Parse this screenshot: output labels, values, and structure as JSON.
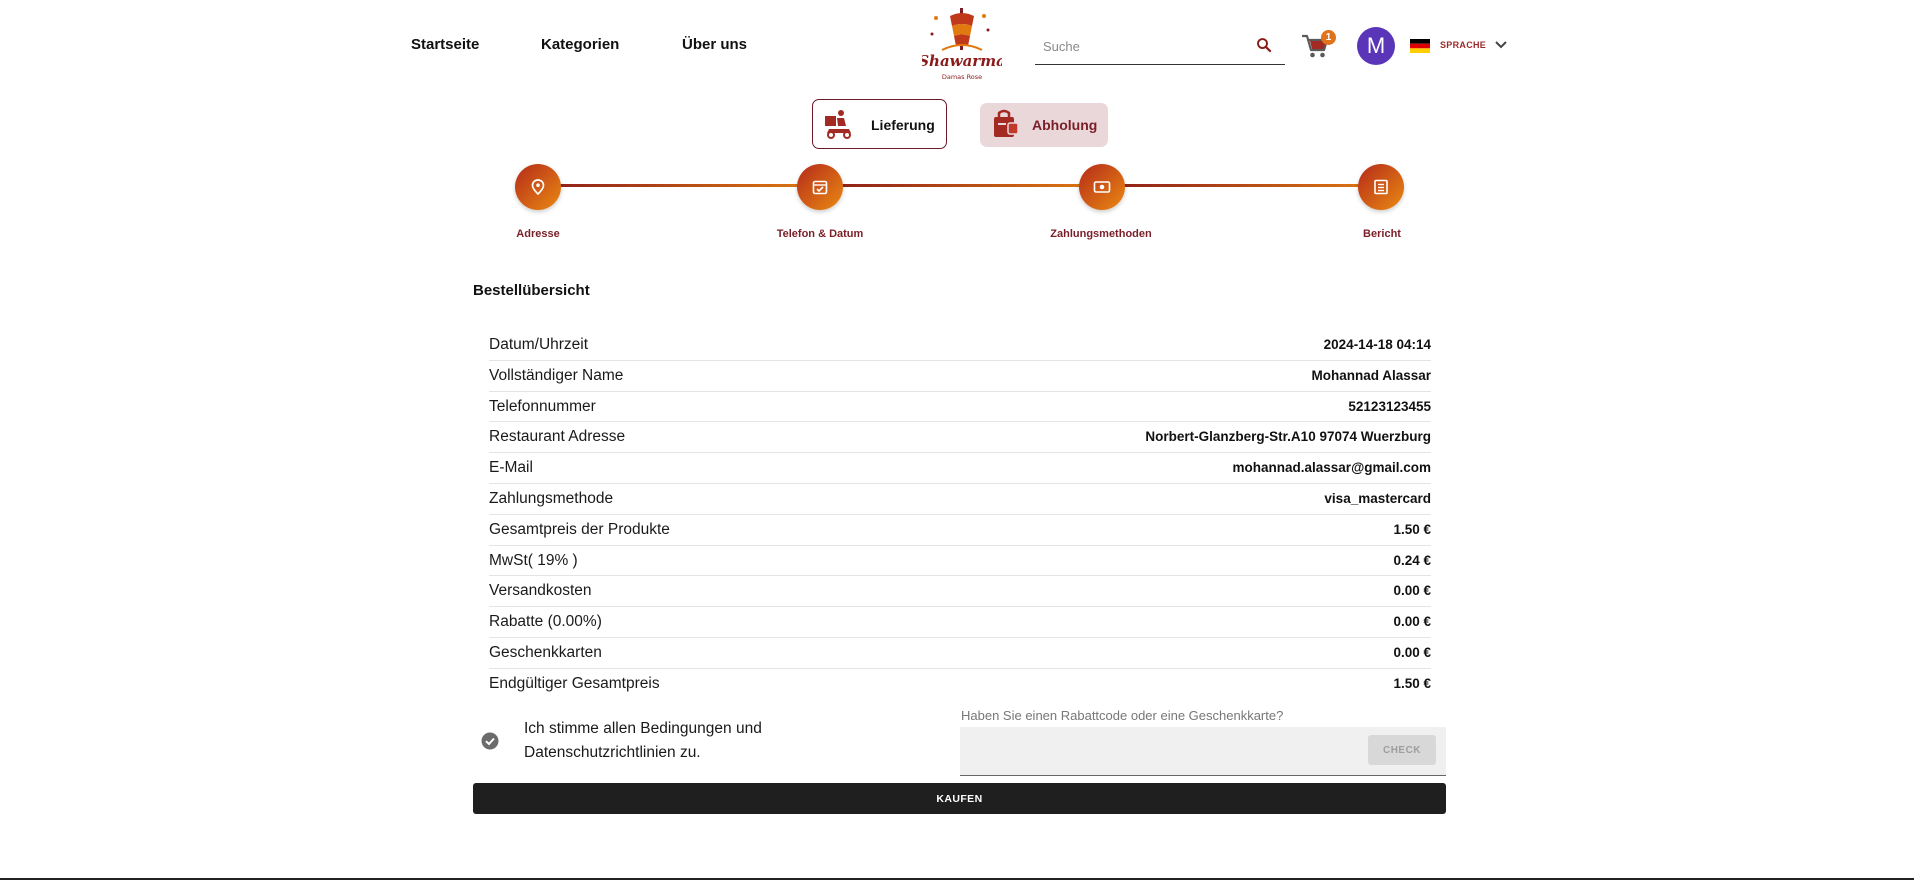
{
  "nav": {
    "home": "Startseite",
    "categories": "Kategorien",
    "about": "Über uns"
  },
  "logo": {
    "word": "Shawarma",
    "sub": "Damas Rose"
  },
  "search": {
    "placeholder": "Suche"
  },
  "cart": {
    "count": "1"
  },
  "user": {
    "initial": "M"
  },
  "language": {
    "label": "SPRACHE",
    "flag": "de-flag-icon"
  },
  "modes": {
    "delivery": "Lieferung",
    "pickup": "Abholung"
  },
  "steps": [
    "Adresse",
    "Telefon & Datum",
    "Zahlungsmethoden",
    "Bericht"
  ],
  "summary": {
    "title": "Bestellübersicht",
    "rows": [
      {
        "label": "Datum/Uhrzeit",
        "value": "2024-14-18 04:14"
      },
      {
        "label": "Vollständiger Name",
        "value": "Mohannad Alassar"
      },
      {
        "label": "Telefonnummer",
        "value": "52123123455"
      },
      {
        "label": "Restaurant Adresse",
        "value": "Norbert-Glanzberg-Str.A10 97074 Wuerzburg"
      },
      {
        "label": "E-Mail",
        "value": "mohannad.alassar@gmail.com"
      },
      {
        "label": "Zahlungsmethode",
        "value": "visa_mastercard"
      },
      {
        "label": "Gesamtpreis der Produkte",
        "value": "1.50 €"
      },
      {
        "label": "MwSt( 19% )",
        "value": "0.24 €"
      },
      {
        "label": "Versandkosten",
        "value": "0.00 €"
      },
      {
        "label": "Rabatte (0.00%)",
        "value": "0.00 €"
      },
      {
        "label": "Geschenkkarten",
        "value": "0.00 €"
      },
      {
        "label": "Endgültiger Gesamtpreis",
        "value": "1.50 €"
      }
    ]
  },
  "terms": {
    "text": "Ich stimme allen Bedingungen und Datenschutzrichtlinien zu.",
    "checked": true
  },
  "coupon": {
    "label": "Haben Sie einen Rabattcode oder eine Geschenkkarte?",
    "value": "",
    "button": "CHECK"
  },
  "buy": {
    "label": "KAUFEN"
  },
  "colors": {
    "brand": "#8b1a1a",
    "accent": "#e07a10",
    "dark": "#1f1f1f"
  }
}
